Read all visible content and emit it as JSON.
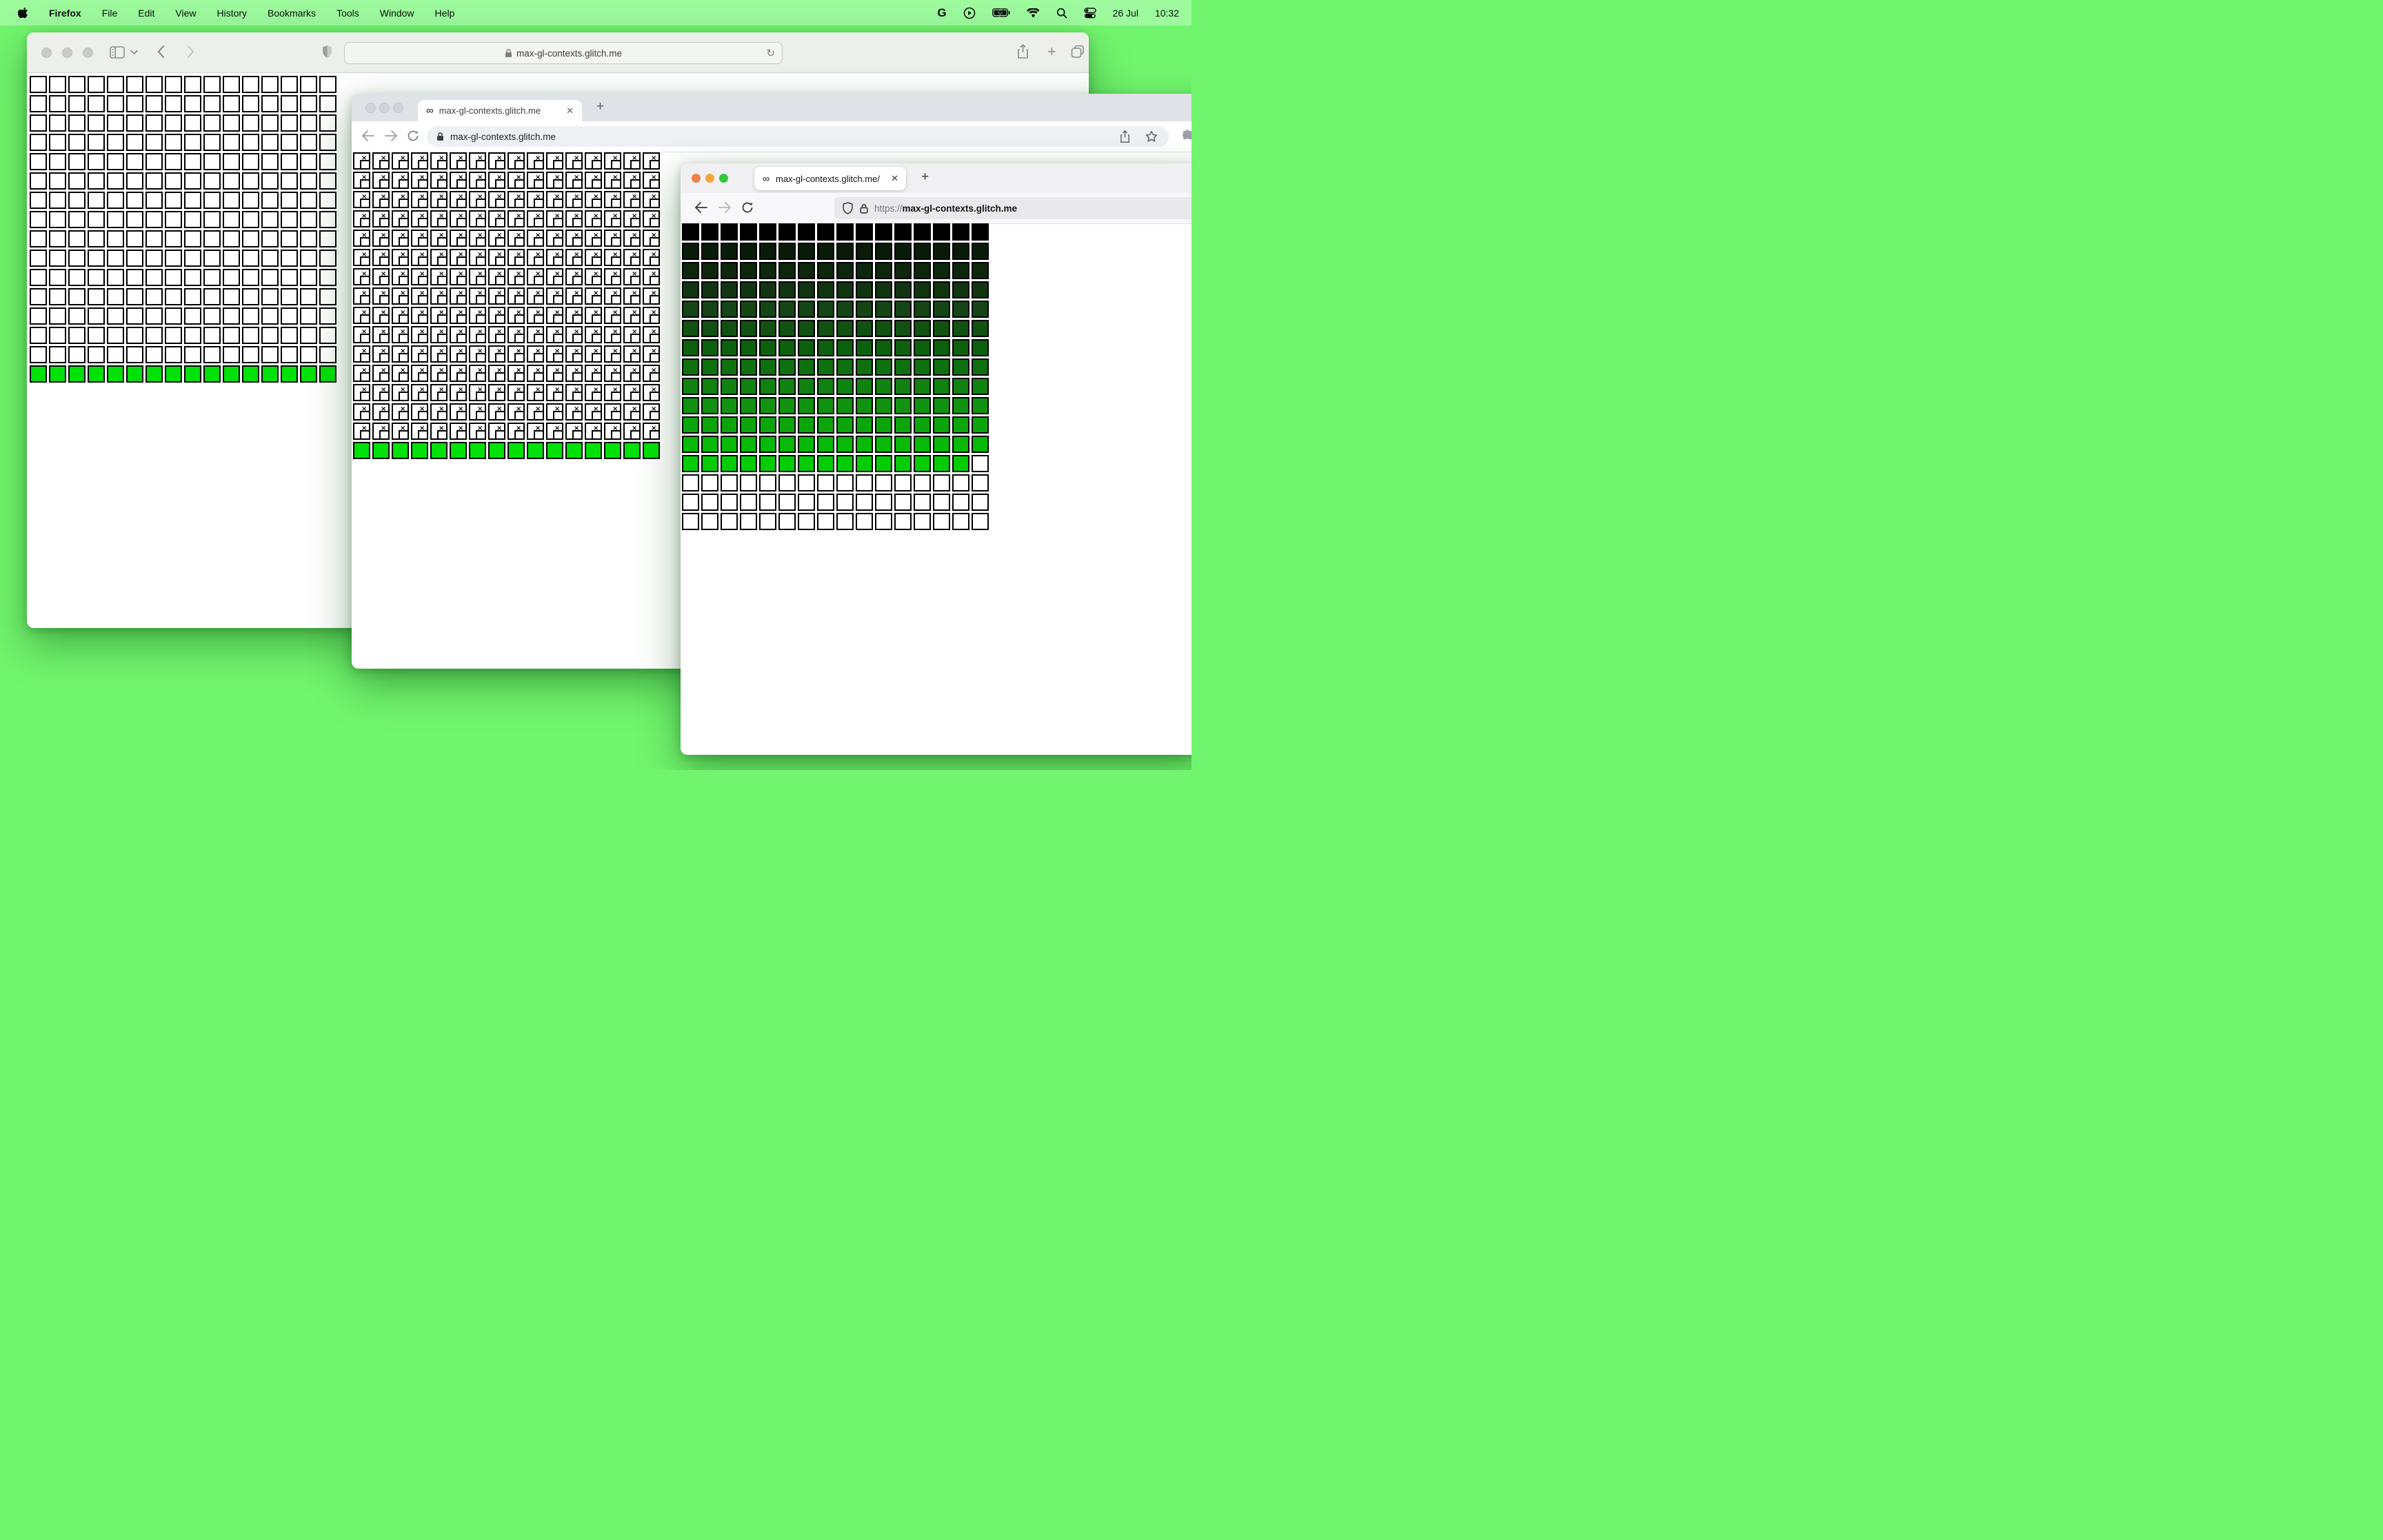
{
  "menu_bar": {
    "app_name": "Firefox",
    "items": [
      "File",
      "Edit",
      "View",
      "History",
      "Bookmarks",
      "Tools",
      "Window",
      "Help"
    ],
    "status_icons": [
      "google-g-icon",
      "play-circle-icon",
      "battery-charging-icon",
      "wifi-icon",
      "search-icon",
      "control-center-icon"
    ],
    "google_g": "G",
    "date": "26 Jul",
    "time": "10:32"
  },
  "safari": {
    "url": "max-gl-contexts.glitch.me"
  },
  "chrome": {
    "tab_title": "max-gl-contexts.glitch.me",
    "favicon": "∞",
    "close_glyph": "✕",
    "new_tab_glyph": "+",
    "url": "max-gl-contexts.glitch.me"
  },
  "firefox": {
    "tab_title": "max-gl-contexts.glitch.me/",
    "favicon": "∞",
    "close_glyph": "✕",
    "new_tab_glyph": "+",
    "url_scheme": "https://",
    "url_host": "max-gl-contexts.glitch.me"
  },
  "traffic_lights": {
    "inactive_gray": "#c9cbc7",
    "firefox_colors": [
      "#f08148",
      "#f2a73b",
      "#31c737"
    ]
  },
  "grids": {
    "cols": 16,
    "green": "#00e109",
    "broken_glyphs": {
      "x": "×",
      "smile": "‿"
    },
    "safari_grid": {
      "rows": [
        "blank",
        "blank",
        "blank",
        "blank",
        "blank",
        "blank",
        "blank",
        "blank",
        "blank",
        "blank",
        "blank",
        "blank",
        "blank",
        "blank",
        "blank",
        "#00e109"
      ]
    },
    "chrome_grid": {
      "rows": [
        "broken",
        "broken",
        "broken",
        "broken",
        "broken",
        "broken",
        "broken",
        "broken",
        "broken",
        "broken",
        "broken",
        "broken",
        "broken",
        "broken",
        "broken",
        "#00e109"
      ]
    },
    "firefox_grid": {
      "rows": [
        "#000000",
        "#0a1b0a",
        "#0d270d",
        "#113511",
        "#154415",
        "#115111",
        "#0d600d",
        "#0f700f",
        "#118111",
        "#119311",
        "#0ca60c",
        "#08b908",
        {
          "color": "#05cd05",
          "tail_blank": 1
        },
        "blank",
        "blank",
        "blank"
      ]
    }
  }
}
